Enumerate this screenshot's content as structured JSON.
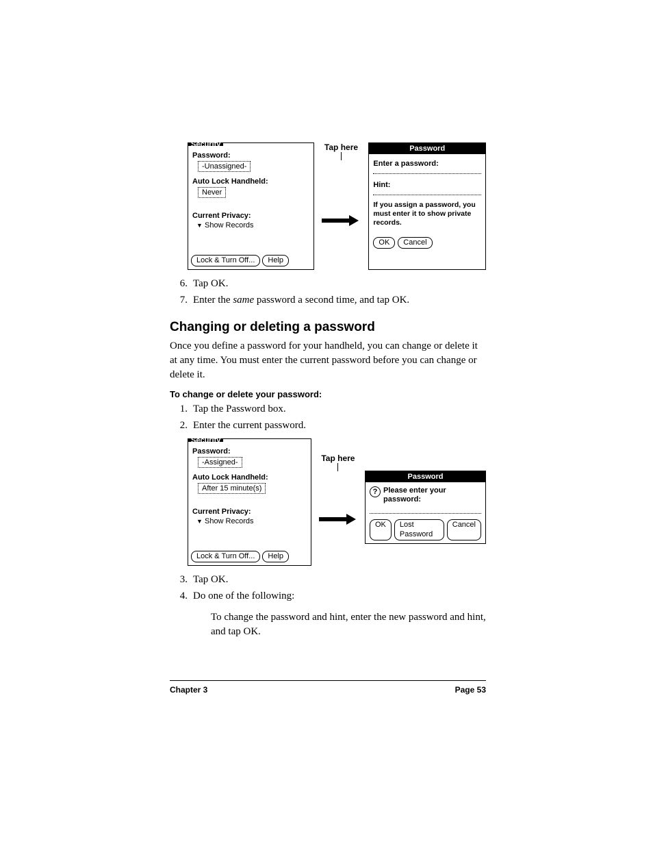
{
  "figure1": {
    "security": {
      "title": "Security",
      "password_label": "Password:",
      "password_value": "-Unassigned-",
      "autolock_label": "Auto Lock Handheld:",
      "autolock_value": "Never",
      "privacy_label": "Current Privacy:",
      "privacy_value": "Show Records",
      "lock_btn": "Lock & Turn Off...",
      "help_btn": "Help"
    },
    "tap_here": "Tap here",
    "password": {
      "title": "Password",
      "enter_label": "Enter a password:",
      "hint_label": "Hint:",
      "msg": "If you assign a password, you must enter it to show private records.",
      "ok": "OK",
      "cancel": "Cancel"
    }
  },
  "steps_a": {
    "s6_num": "6.",
    "s6": "Tap OK.",
    "s7_num": "7.",
    "s7_a": "Enter the ",
    "s7_em": "same",
    "s7_b": " password a second time, and tap OK."
  },
  "heading": "Changing or deleting a password",
  "para1": "Once you define a password for your handheld, you can change or delete it at any time. You must enter the current password before you can change or delete it.",
  "subheading": "To change or delete your password:",
  "steps_b": {
    "s1_num": "1.",
    "s1": "Tap the Password box.",
    "s2_num": "2.",
    "s2": "Enter the current password."
  },
  "figure2": {
    "security": {
      "title": "Security",
      "password_label": "Password:",
      "password_value": "-Assigned-",
      "autolock_label": "Auto Lock Handheld:",
      "autolock_value": "After 15 minute(s)",
      "privacy_label": "Current Privacy:",
      "privacy_value": "Show Records",
      "lock_btn": "Lock & Turn Off...",
      "help_btn": "Help"
    },
    "tap_here": "Tap here",
    "password": {
      "title": "Password",
      "prompt": "Please enter your password:",
      "ok": "OK",
      "lost": "Lost Password",
      "cancel": "Cancel"
    }
  },
  "steps_c": {
    "s3_num": "3.",
    "s3": "Tap OK.",
    "s4_num": "4.",
    "s4": "Do one of the following:"
  },
  "para2": "To change the password and hint, enter the new password and hint, and tap OK.",
  "footer": {
    "left": "Chapter 3",
    "right": "Page 53"
  }
}
